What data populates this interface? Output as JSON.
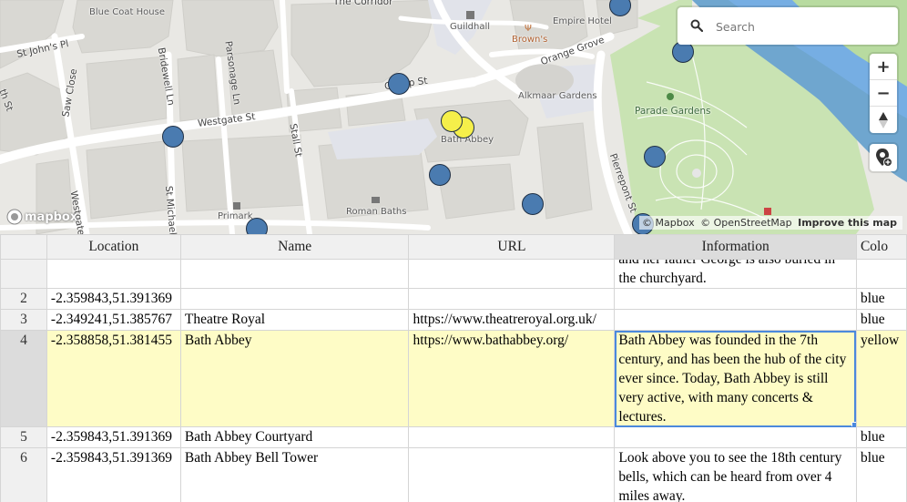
{
  "map": {
    "search_placeholder": "Search",
    "zoom_in": "+",
    "zoom_out": "−",
    "attribution": {
      "mapbox": "© Mapbox",
      "osm": "© OpenStreetMap",
      "improve": "Improve this map"
    },
    "logo_text": "mapbox",
    "labels": {
      "blue_coat_house": "Blue Coat House",
      "the_corridor": "The Corridor",
      "guildhall": "Guildhall",
      "empire_hotel": "Empire Hotel",
      "browns": "Brown's",
      "orange_grove": "Orange Grove",
      "st_johns_pl": "St John's Pl",
      "bridewell_ln": "Bridewell Ln",
      "parsonage_ln": "Parsonage Ln",
      "saw_close": "Saw Close",
      "westgate_st": "Westgate St",
      "cheap_st": "Cheap St",
      "alkmaar_gardens": "Alkmaar Gardens",
      "parade_gardens": "Parade Gardens",
      "bath_abbey": "Bath Abbey",
      "stall_st": "Stall St",
      "pierrepont_st": "Pierrepont St",
      "st_michael": "St Michael",
      "westgate_b": "Westgate",
      "primark": "Primark",
      "roman_baths": "Roman Baths",
      "th_st": "th St"
    },
    "markers": [
      {
        "color": "blue"
      },
      {
        "color": "blue"
      },
      {
        "color": "blue"
      },
      {
        "color": "blue"
      },
      {
        "color": "blue"
      },
      {
        "color": "yellow"
      },
      {
        "color": "blue"
      },
      {
        "color": "blue"
      },
      {
        "color": "blue"
      },
      {
        "color": "blue"
      },
      {
        "color": "blue"
      },
      {
        "color": "blue"
      }
    ]
  },
  "grid": {
    "columns": [
      "Location",
      "Name",
      "URL",
      "Information",
      "Colo"
    ],
    "rows": [
      {
        "num": "",
        "location": "",
        "name": "",
        "url": "",
        "info_line1": "and her father George is also buried in",
        "info_line2": "the churchyard.",
        "color": ""
      },
      {
        "num": "2",
        "location": "-2.359843,51.391369",
        "name": "",
        "url": "",
        "info": "",
        "color": "blue"
      },
      {
        "num": "3",
        "location": "-2.349241,51.385767",
        "name": "Theatre Royal",
        "url": "https://www.theatreroyal.org.uk/",
        "info": "",
        "color": "blue"
      },
      {
        "num": "4",
        "location": "-2.358858,51.381455",
        "name": "Bath Abbey",
        "url": "https://www.bathabbey.org/",
        "info": "Bath Abbey was founded in the 7th century, and has been the hub of the city ever since. Today, Bath Abbey is still very active, with many concerts & lectures.",
        "color": "yellow"
      },
      {
        "num": "5",
        "location": "-2.359843,51.391369",
        "name": "Bath Abbey Courtyard",
        "url": "",
        "info": "",
        "color": "blue"
      },
      {
        "num": "6",
        "location": "-2.359843,51.391369",
        "name": "Bath Abbey Bell Tower",
        "url": "",
        "info": "Look above you to see the 18th century bells, which can be heard from over 4 miles away.",
        "color": "blue"
      }
    ]
  }
}
